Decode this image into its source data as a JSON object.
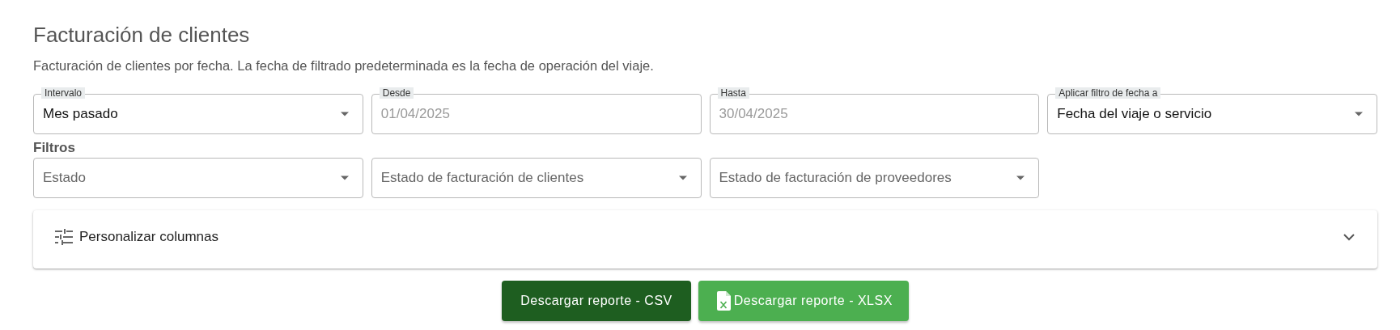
{
  "header": {
    "title": "Facturación de clientes",
    "subtitle": "Facturación de clientes por fecha. La fecha de filtrado predeterminada es la fecha de operación del viaje."
  },
  "date_fields": [
    {
      "kind": "select",
      "label": "Intervalo",
      "value": "Mes pasado",
      "disabled": false
    },
    {
      "kind": "date",
      "label": "Desde",
      "value": "01/04/2025",
      "disabled": true
    },
    {
      "kind": "date",
      "label": "Hasta",
      "value": "30/04/2025",
      "disabled": true
    },
    {
      "kind": "select",
      "label": "Aplicar filtro de fecha a",
      "value": "Fecha del viaje o servicio",
      "disabled": false
    }
  ],
  "filters": {
    "heading": "Filtros",
    "fields": [
      {
        "kind": "select",
        "placeholder": "Estado"
      },
      {
        "kind": "select",
        "placeholder": "Estado de facturación de clientes"
      },
      {
        "kind": "select",
        "placeholder": "Estado de facturación de proveedores"
      }
    ]
  },
  "customize_columns": {
    "label": "Personalizar columnas",
    "expanded": false
  },
  "buttons": [
    {
      "kind": "csv",
      "label": "Descargar reporte - CSV"
    },
    {
      "kind": "xlsx",
      "label": "Descargar reporte - XLSX"
    }
  ]
}
